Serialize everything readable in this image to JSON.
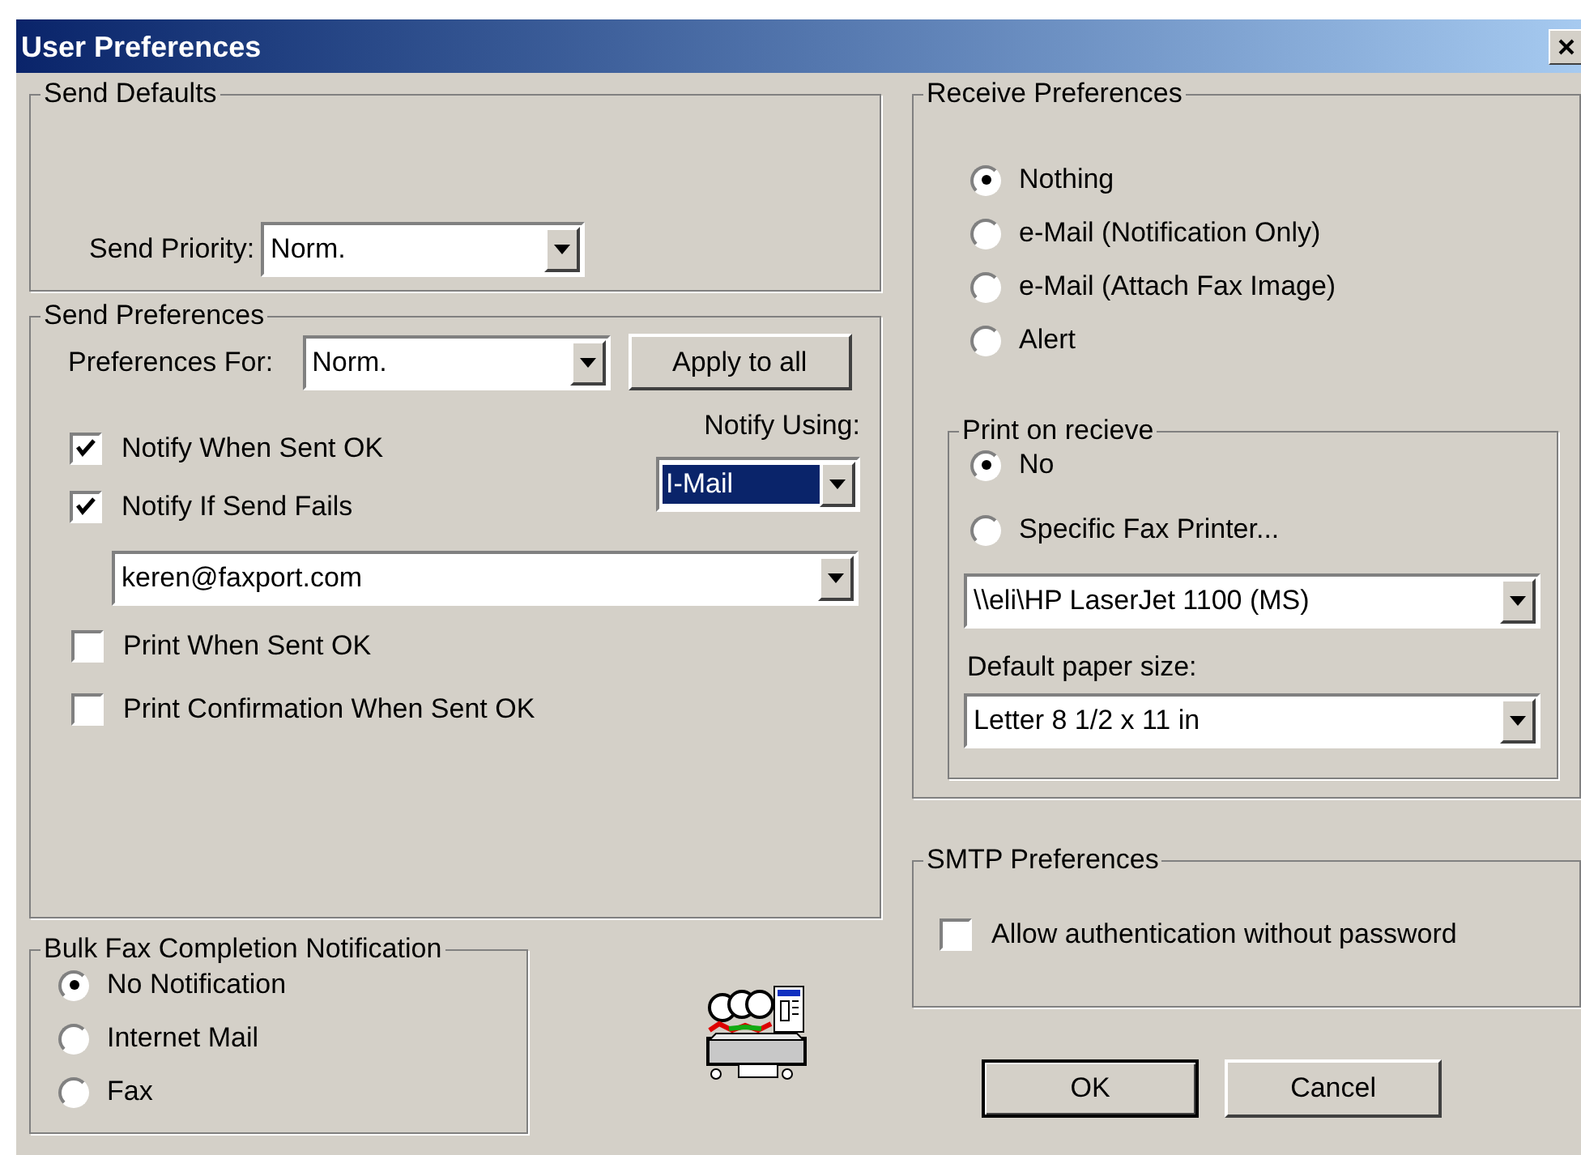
{
  "window": {
    "title": "User Preferences"
  },
  "send_defaults": {
    "title": "Send Defaults",
    "send_priority": {
      "label": "Send Priority:",
      "value": "Norm."
    }
  },
  "send_preferences": {
    "title": "Send Preferences",
    "preferences_for": {
      "label": "Preferences For:",
      "value": "Norm."
    },
    "apply_button": "Apply to all",
    "notify_options": [
      {
        "label": "Notify When Sent OK",
        "checked": true
      },
      {
        "label": "Notify If Send Fails",
        "checked": true
      }
    ],
    "notify_using": {
      "label": "Notify Using:",
      "value": "I-Mail",
      "highlighted": true
    },
    "email": {
      "value": "keren@faxport.com"
    },
    "print_options": [
      {
        "label": "Print When Sent OK",
        "checked": false
      },
      {
        "label": "Print Confirmation When Sent OK",
        "checked": false
      }
    ]
  },
  "bulk_fax_notification": {
    "title": "Bulk Fax Completion Notification",
    "options": [
      {
        "label": "No Notification",
        "selected": true
      },
      {
        "label": "Internet Mail",
        "selected": false
      },
      {
        "label": "Fax",
        "selected": false
      }
    ]
  },
  "receive_preferences": {
    "title": "Receive Preferences",
    "options": [
      {
        "label": "Nothing",
        "selected": true
      },
      {
        "label": "e-Mail (Notification Only)",
        "selected": false
      },
      {
        "label": "e-Mail (Attach Fax Image)",
        "selected": false
      },
      {
        "label": "Alert",
        "selected": false
      }
    ],
    "print_on_receive": {
      "title": "Print on recieve",
      "options": [
        {
          "label": "No",
          "selected": true
        },
        {
          "label": "Specific Fax Printer...",
          "selected": false
        }
      ],
      "printer": {
        "value": "\\\\eli\\HP LaserJet 1100 (MS)"
      },
      "paper_size": {
        "label": "Default paper size:",
        "value": "Letter 8 1/2 x 11 in"
      }
    }
  },
  "smtp_preferences": {
    "title": "SMTP Preferences",
    "options": [
      {
        "label": "Allow authentication without password",
        "checked": false
      }
    ]
  },
  "buttons": [
    {
      "label": "OK",
      "default": true
    },
    {
      "label": "Cancel",
      "default": false
    }
  ]
}
